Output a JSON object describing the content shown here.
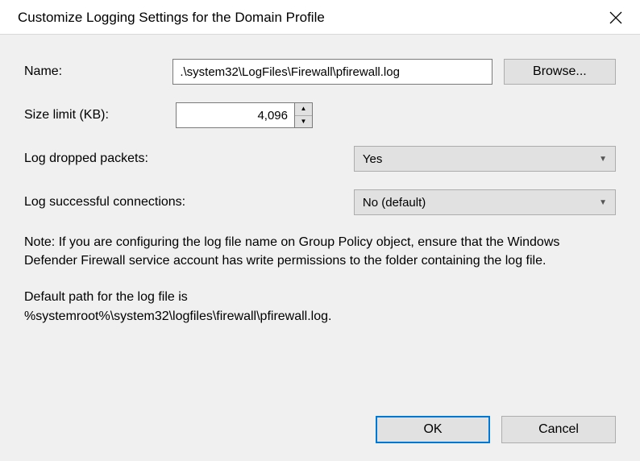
{
  "titlebar": {
    "title": "Customize Logging Settings for the Domain Profile"
  },
  "form": {
    "name_label": "Name:",
    "name_value": ".\\system32\\LogFiles\\Firewall\\pfirewall.log",
    "browse_label": "Browse...",
    "size_label": "Size limit (KB):",
    "size_value": "4,096",
    "dropped_label": "Log dropped packets:",
    "dropped_value": "Yes",
    "success_label": "Log successful connections:",
    "success_value": "No (default)"
  },
  "note": "Note: If you are configuring the log file name on Group Policy object, ensure that the Windows Defender Firewall service account has write permissions to the folder containing the log file.",
  "default_path_intro": "Default path for the log file is",
  "default_path_value": "%systemroot%\\system32\\logfiles\\firewall\\pfirewall.log.",
  "buttons": {
    "ok": "OK",
    "cancel": "Cancel"
  }
}
